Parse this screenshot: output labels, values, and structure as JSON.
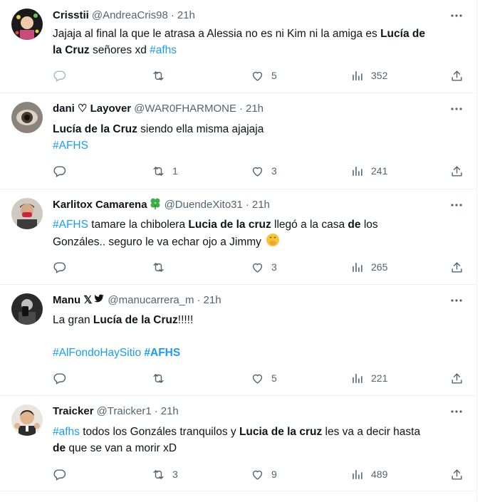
{
  "tweets": [
    {
      "name": "Crisstii",
      "handle": "@AndreaCris98",
      "time": "21h",
      "lines": [
        [
          {
            "t": "Jajaja al final la que le atrasa a Alessia no es ni Kim ni la amiga es "
          },
          {
            "t": "Lucía de",
            "b": true
          }
        ],
        [
          {
            "t": "la Cruz",
            "b": true
          },
          {
            "t": " señores xd "
          },
          {
            "t": "#afhs",
            "tag": true
          }
        ]
      ],
      "replies": "",
      "retweets": "",
      "likes": "5",
      "views": "352",
      "reply_icon_style": "light"
    },
    {
      "name": "dani ♡ Layover",
      "handle": "@WAR0FHARMONE",
      "time": "21h",
      "lines": [
        [
          {
            "t": "Lucía de la Cruz",
            "b": true
          },
          {
            "t": " siendo ella misma ajajaja"
          }
        ],
        [
          {
            "t": " #AFHS",
            "tag": true
          }
        ]
      ],
      "replies": "",
      "retweets": "1",
      "likes": "3",
      "views": "241"
    },
    {
      "name": "Karlitox Camarena",
      "name_emoji": "four-leaf-clover-icon",
      "handle": "@DuendeXito31",
      "time": "21h",
      "lines": [
        [
          {
            "t": "#AFHS",
            "tag": true
          },
          {
            "t": " tamare la chibolera "
          },
          {
            "t": "Lucia de la cruz",
            "b": true
          },
          {
            "t": " llegó a la casa "
          },
          {
            "t": "de",
            "b": true
          },
          {
            "t": " los"
          }
        ],
        [
          {
            "t": "Gonzáles.. seguro le va echar ojo a Jimmy "
          }
        ]
      ],
      "line_emoji": "face-hand-over-mouth-icon",
      "replies": "",
      "retweets": "",
      "likes": "3",
      "views": "265"
    },
    {
      "name": "Manu 𝕏",
      "name_emoji": "twitter-bird-icon",
      "handle": "@manucarrera_m",
      "time": "21h",
      "lines": [
        [
          {
            "t": "La gran "
          },
          {
            "t": "Lucía de la Cruz",
            "b": true
          },
          {
            "t": "!!!!!"
          }
        ],
        [
          {
            "t": ""
          }
        ],
        [
          {
            "t": "#AlFondoHaySitio",
            "tag": true
          },
          {
            "t": " "
          },
          {
            "t": "#AFHS",
            "tag": true,
            "b": true
          }
        ]
      ],
      "replies": "",
      "retweets": "",
      "likes": "5",
      "views": "221"
    },
    {
      "name": "Traicker",
      "handle": "@Traicker1",
      "time": "21h",
      "lines": [
        [
          {
            "t": "#afhs",
            "tag": true
          },
          {
            "t": " todos los Gonzáles tranquilos y "
          },
          {
            "t": "Lucia de la cruz",
            "b": true
          },
          {
            "t": " les va a decir hasta"
          }
        ],
        [
          {
            "t": "de",
            "b": true
          },
          {
            "t": " que se van a morir xD"
          }
        ]
      ],
      "replies": "",
      "retweets": "3",
      "likes": "9",
      "views": "489"
    }
  ],
  "colors": {
    "text": "#0f1419",
    "muted": "#536471",
    "link": "#1d9bf0",
    "border": "#eff3f4"
  }
}
